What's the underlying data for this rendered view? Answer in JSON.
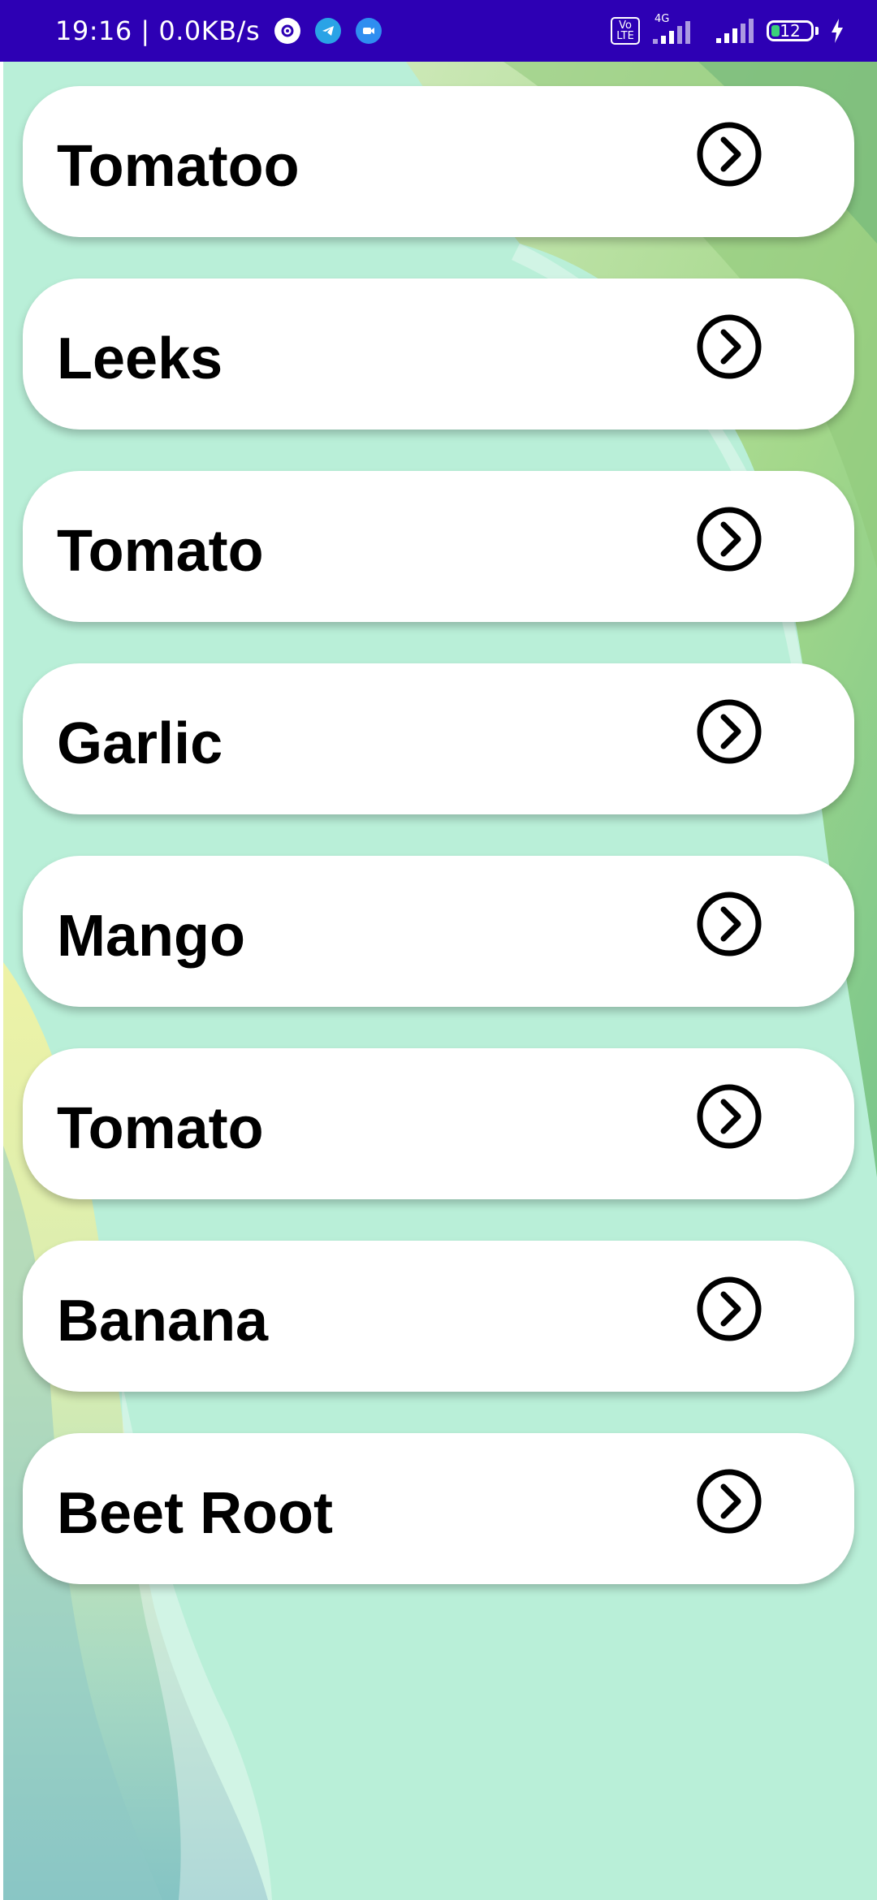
{
  "status_bar": {
    "time_speed": "19:16 | 0.0KB/s",
    "volte": "Vo LTE",
    "network": "4G",
    "battery": "12",
    "icons": [
      "settings-app-icon",
      "telegram-icon",
      "video-call-icon",
      "signal-icon",
      "charging-icon"
    ],
    "background": "#2d00b4"
  },
  "list": {
    "items": [
      {
        "label": "Tomatoo",
        "icon": "chevron-right-circle-icon"
      },
      {
        "label": "Leeks",
        "icon": "chevron-right-circle-icon"
      },
      {
        "label": "Tomato",
        "icon": "chevron-right-circle-icon"
      },
      {
        "label": "Garlic",
        "icon": "chevron-right-circle-icon"
      },
      {
        "label": "Mango",
        "icon": "chevron-right-circle-icon"
      },
      {
        "label": "Tomato",
        "icon": "chevron-right-circle-icon"
      },
      {
        "label": "Banana",
        "icon": "chevron-right-circle-icon"
      },
      {
        "label": "Beet Root",
        "icon": "chevron-right-circle-icon"
      }
    ]
  },
  "colors": {
    "background": "#b9efd8",
    "card": "#ffffff",
    "text": "#000000"
  }
}
